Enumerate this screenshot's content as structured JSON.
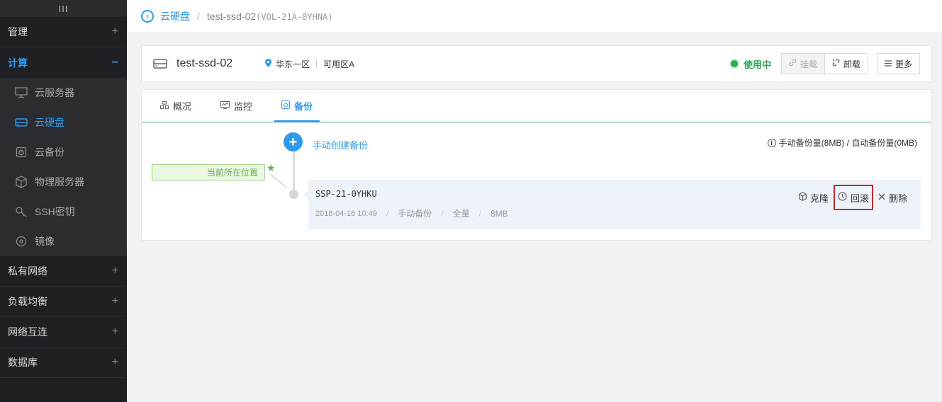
{
  "sidebar": {
    "collapse_label": "III",
    "groups_top": [
      {
        "label": "管理",
        "toggle": "+"
      }
    ],
    "active_group": {
      "label": "计算",
      "toggle": "−"
    },
    "compute_items": [
      {
        "label": "云服务器",
        "icon": "monitor-icon"
      },
      {
        "label": "云硬盘",
        "icon": "disk-icon"
      },
      {
        "label": "云备份",
        "icon": "backup-icon"
      },
      {
        "label": "物理服务器",
        "icon": "cube-icon"
      },
      {
        "label": "SSH密钥",
        "icon": "key-icon"
      },
      {
        "label": "镜像",
        "icon": "disc-icon"
      }
    ],
    "groups_bottom": [
      {
        "label": "私有网络",
        "toggle": "+"
      },
      {
        "label": "负载均衡",
        "toggle": "+"
      },
      {
        "label": "网络互连",
        "toggle": "+"
      },
      {
        "label": "数据库",
        "toggle": "+"
      }
    ]
  },
  "breadcrumb": {
    "back_icon": "‹",
    "parent": "云硬盘",
    "separator": "/",
    "current_name": "test-ssd-02",
    "current_id": "(VOL-21A-0YHNA)"
  },
  "disk": {
    "name": "test-ssd-02",
    "region": "华东一区",
    "zone": "可用区A",
    "status": "使用中",
    "status_color": "#2da94f"
  },
  "toolbar": {
    "mount_label": "挂载",
    "unmount_label": "卸载",
    "more_label": "更多"
  },
  "tabs": [
    {
      "label": "概况",
      "icon": "overview-icon"
    },
    {
      "label": "监控",
      "icon": "monitor-chart-icon"
    },
    {
      "label": "备份",
      "icon": "backup-icon"
    }
  ],
  "backup_tab": {
    "create_label": "手动创建备份",
    "quota_text": "手动备份量(8MB) / 自动备份量(0MB)",
    "current_position_label": "当前所在位置",
    "item": {
      "name": "SSP-21-0YHKU",
      "date": "2018-04-16 10:49",
      "type": "手动备份",
      "scope": "全量",
      "size": "8MB",
      "meta_sep": "/",
      "actions": {
        "clone": "克隆",
        "rollback": "回滚",
        "delete": "删除"
      }
    }
  },
  "colors": {
    "accent": "#2d9bf0",
    "sidebar_bg": "#1f2023",
    "highlight": "#e02020"
  }
}
